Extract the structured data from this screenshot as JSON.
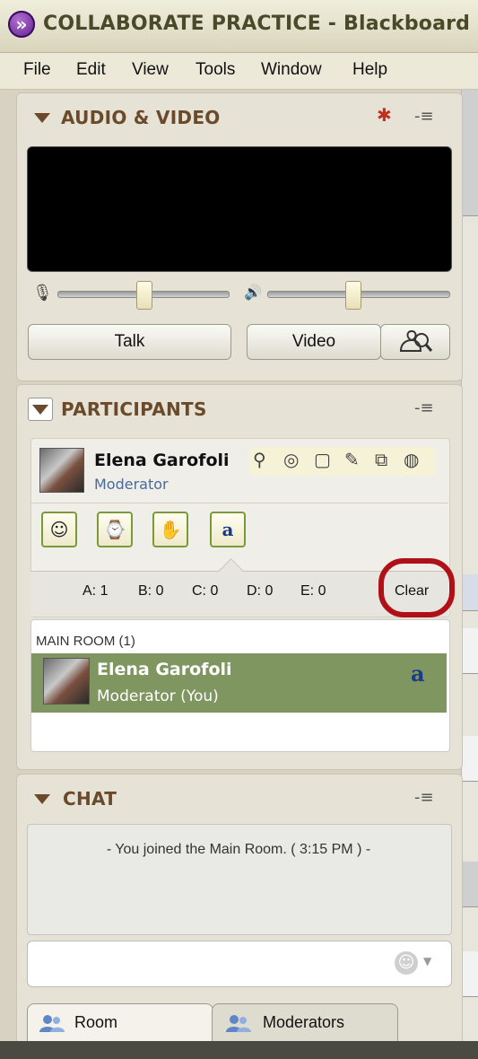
{
  "app": {
    "title": "COLLABORATE PRACTICE - Blackboard C"
  },
  "menu": [
    "File",
    "Edit",
    "View",
    "Tools",
    "Window",
    "Help"
  ],
  "audio_video": {
    "title": "AUDIO & VIDEO",
    "talk_label": "Talk",
    "video_label": "Video",
    "mic_level": 0.5,
    "speaker_level": 0.5
  },
  "participants": {
    "title": "PARTICIPANTS",
    "me": {
      "name": "Elena Garofoli",
      "role": "Moderator"
    },
    "status_buttons": [
      "emoticon",
      "step-away",
      "raise-hand",
      "a"
    ],
    "poll_counts": {
      "a": "A: 1",
      "b": "B: 0",
      "c": "C: 0",
      "d": "D: 0",
      "e": "E: 0"
    },
    "clear_label": "Clear",
    "room_label": "MAIN ROOM (1)",
    "list": [
      {
        "name": "Elena Garofoli",
        "role": "Moderator (You)",
        "response": "a"
      }
    ]
  },
  "chat": {
    "title": "CHAT",
    "messages": [
      "- You joined the Main Room. ( 3:15 PM ) -"
    ],
    "tabs": [
      "Room",
      "Moderators"
    ]
  },
  "colors": {
    "header_text": "#6a4a2a",
    "selected_row": "#7f9660",
    "highlight_ring": "#b01018"
  }
}
